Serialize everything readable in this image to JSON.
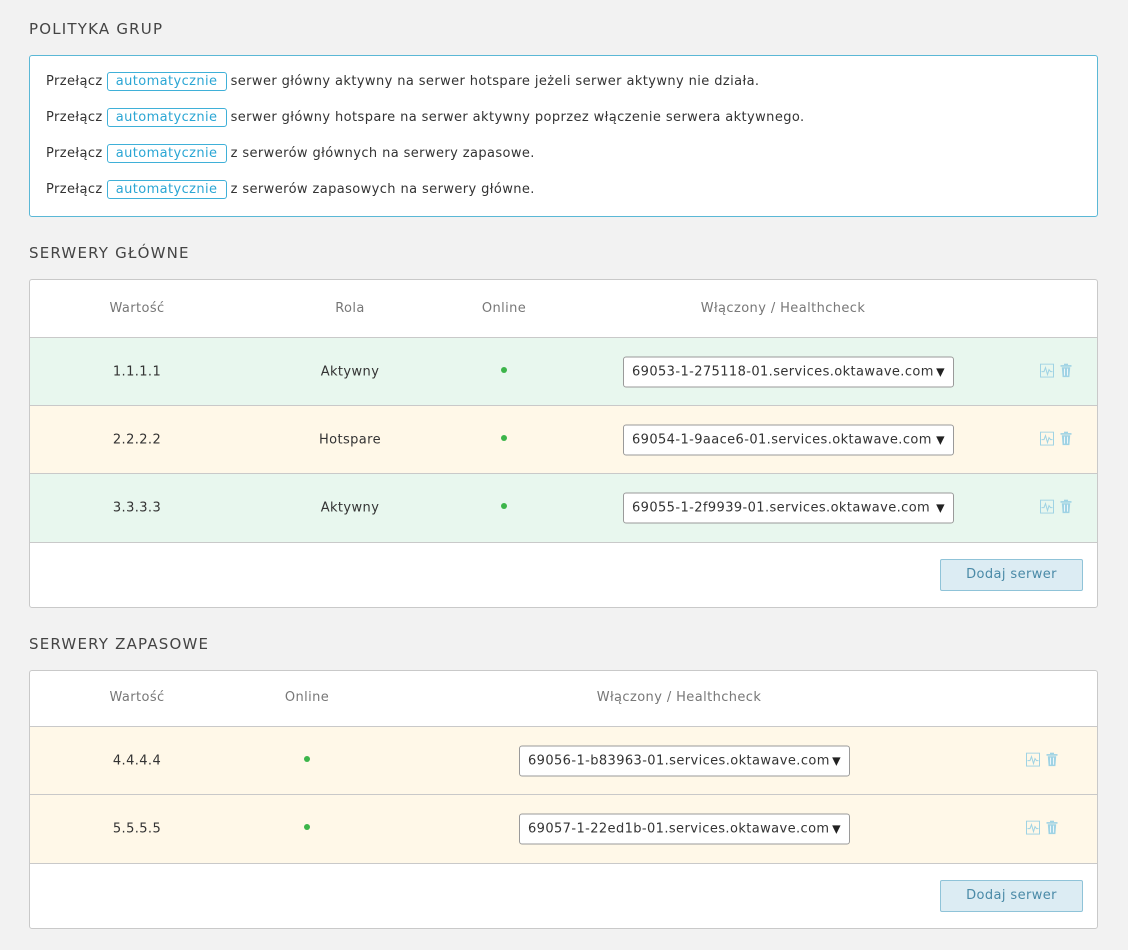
{
  "policy": {
    "title": "POLITYKA GRUP",
    "rows": [
      {
        "prefix": "Przełącz",
        "mode": "automatycznie",
        "text": "serwer główny aktywny na serwer hotspare jeżeli serwer aktywny nie działa."
      },
      {
        "prefix": "Przełącz",
        "mode": "automatycznie",
        "text": "serwer główny hotspare na serwer aktywny poprzez włączenie serwera aktywnego."
      },
      {
        "prefix": "Przełącz",
        "mode": "automatycznie",
        "text": "z serwerów głównych na serwery zapasowe."
      },
      {
        "prefix": "Przełącz",
        "mode": "automatycznie",
        "text": "z serwerów zapasowych na serwery główne."
      }
    ]
  },
  "primary": {
    "title": "SERWERY GŁÓWNE",
    "headers": {
      "value": "Wartość",
      "role": "Rola",
      "online": "Online",
      "healthcheck": "Włączony / Healthcheck"
    },
    "rows": [
      {
        "value": "1.1.1.1",
        "role": "Aktywny",
        "healthcheck": "69053-1-275118-01.services.oktawave.com",
        "status": "active"
      },
      {
        "value": "2.2.2.2",
        "role": "Hotspare",
        "healthcheck": "69054-1-9aace6-01.services.oktawave.com",
        "status": "hotspare"
      },
      {
        "value": "3.3.3.3",
        "role": "Aktywny",
        "healthcheck": "69055-1-2f9939-01.services.oktawave.com",
        "status": "active"
      }
    ],
    "add_label": "Dodaj serwer"
  },
  "backup": {
    "title": "SERWERY ZAPASOWE",
    "headers": {
      "value": "Wartość",
      "online": "Online",
      "healthcheck": "Włączony / Healthcheck"
    },
    "rows": [
      {
        "value": "4.4.4.4",
        "healthcheck": "69056-1-b83963-01.services.oktawave.com"
      },
      {
        "value": "5.5.5.5",
        "healthcheck": "69057-1-22ed1b-01.services.oktawave.com"
      }
    ],
    "add_label": "Dodaj serwer"
  },
  "colors": {
    "accent": "#2ba6d4",
    "online": "#3cb54a",
    "active_row": "#e8f7ee",
    "hotspare_row": "#fff8e8",
    "icon": "#7cc7df"
  },
  "icons": {
    "healthcheck": "pulse-chart-icon",
    "delete": "trash-icon",
    "dropdown": "chevron-down-icon"
  }
}
